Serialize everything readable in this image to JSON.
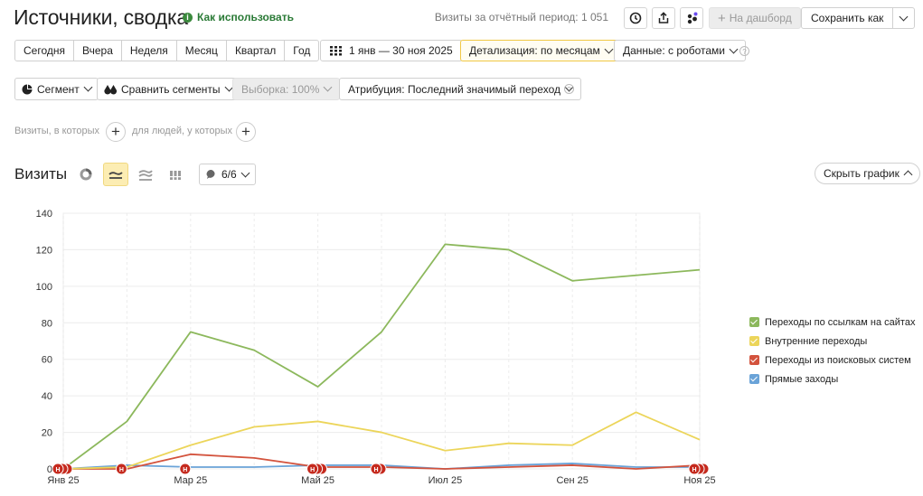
{
  "header": {
    "title": "Источники, сводка",
    "howto_label": "Как использовать",
    "visits_period": "Визиты за отчётный период: 1 051",
    "dashboard_label": "На дашборд",
    "save_as_label": "Сохранить как"
  },
  "toolbar": {
    "periods": [
      "Сегодня",
      "Вчера",
      "Неделя",
      "Месяц",
      "Квартал",
      "Год"
    ],
    "date_range": "1 янв — 30 ноя 2025",
    "detail_label": "Детализация: по месяцам",
    "data_label": "Данные: с роботами"
  },
  "segments": {
    "segment_label": "Сегмент",
    "compare_label": "Сравнить сегменты",
    "sample_label": "Выборка: 100%",
    "attribution_label": "Атрибуция: Последний значимый переход"
  },
  "filters": {
    "visits_which": "Визиты, в которых",
    "people_which": "для людей, у которых"
  },
  "chart_section": {
    "title": "Визиты",
    "series_counter": "6/6",
    "hide_label": "Скрыть график"
  },
  "chart_data": {
    "type": "line",
    "x": [
      "Янв 25",
      "Фев 25",
      "Мар 25",
      "Апр 25",
      "Май 25",
      "Июн 25",
      "Июл 25",
      "Авг 25",
      "Сен 25",
      "Окт 25",
      "Ноя 25"
    ],
    "x_tick_labels": [
      "Янв 25",
      "Мар 25",
      "Май 25",
      "Июл 25",
      "Сен 25",
      "Ноя 25"
    ],
    "ylim": [
      0,
      140
    ],
    "y_ticks": [
      0,
      20,
      40,
      60,
      80,
      100,
      120,
      140
    ],
    "grid": true,
    "legend_position": "right",
    "series": [
      {
        "name": "Переходы по ссылкам на сайтах",
        "color": "#8cb85c",
        "values": [
          0,
          26,
          75,
          65,
          45,
          75,
          123,
          120,
          103,
          106,
          109
        ]
      },
      {
        "name": "Внутренние переходы",
        "color": "#ecd55a",
        "values": [
          0,
          1,
          13,
          23,
          26,
          20,
          10,
          14,
          13,
          31,
          16
        ]
      },
      {
        "name": "Переходы из поисковых систем",
        "color": "#d3533d",
        "values": [
          0,
          0,
          8,
          6,
          1,
          1,
          0,
          1,
          2,
          0,
          2
        ]
      },
      {
        "name": "Прямые заходы",
        "color": "#6aa3d8",
        "values": [
          0,
          2,
          1,
          1,
          2,
          2,
          0,
          2,
          3,
          1,
          1
        ]
      }
    ],
    "annotation_marker": "Н",
    "annotations": [
      {
        "x": 0,
        "count": 3
      },
      {
        "x": 1,
        "count": 1
      },
      {
        "x": 2,
        "count": 1
      },
      {
        "x": 4,
        "count": 3
      },
      {
        "x": 5,
        "count": 2
      },
      {
        "x": 10,
        "count": 3
      }
    ]
  }
}
